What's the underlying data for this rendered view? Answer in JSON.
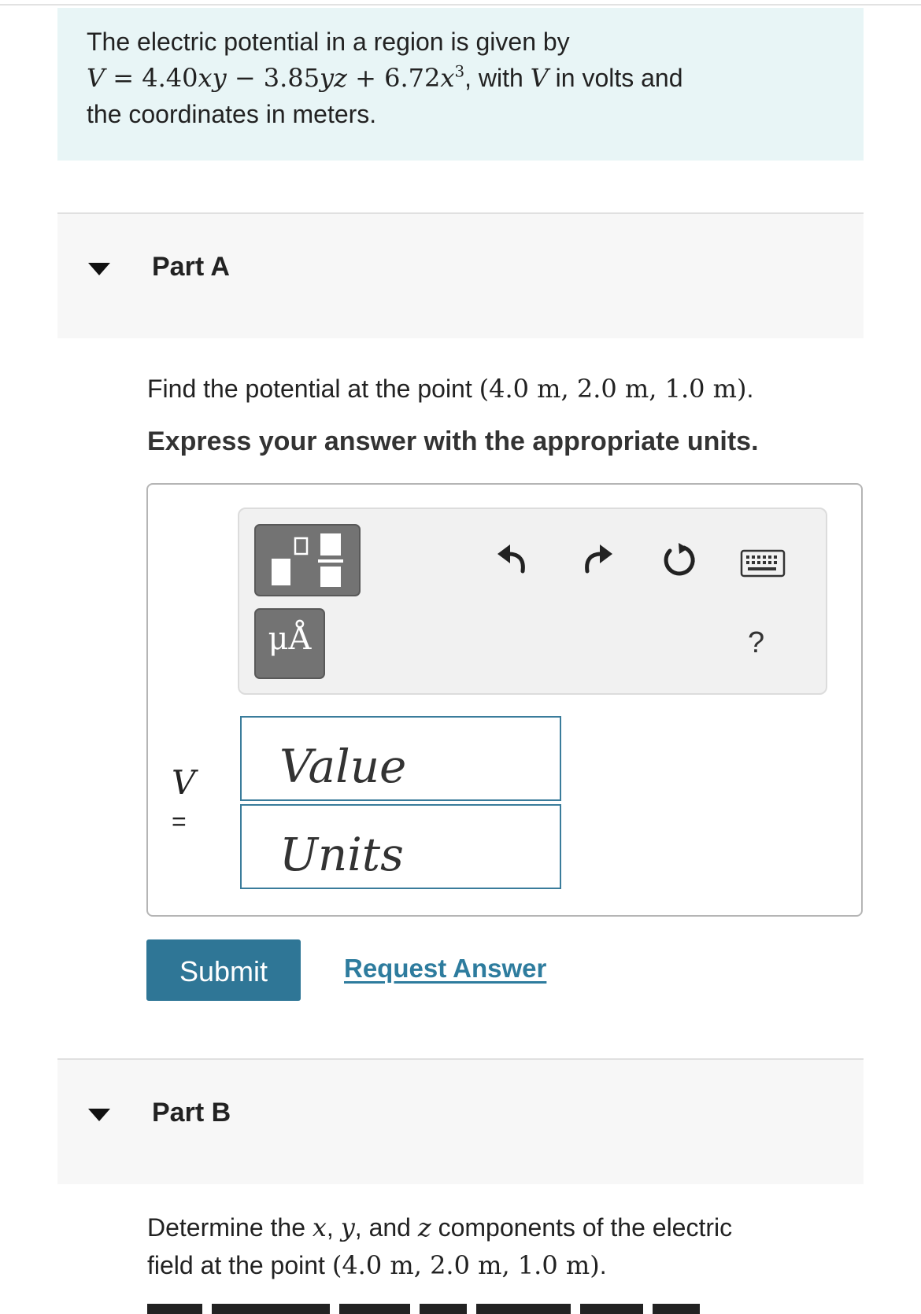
{
  "intro": {
    "line1": "The electric potential in a region is given by",
    "formula": {
      "lhs": "V",
      "eq": " = ",
      "term1": "4.40",
      "term1_vars": "xy",
      "op1": " − ",
      "term2": "3.85",
      "term2_vars": "yz",
      "op2": " + ",
      "term3": "6.72",
      "term3_var": "x",
      "term3_exp": "3"
    },
    "after_formula": ", with ",
    "v_symbol": "V",
    "after_v": " in volts and",
    "line3": "the coordinates in meters."
  },
  "part_a": {
    "title": "Part A",
    "question_prefix": "Find the potential at the point ",
    "point": "(4.0 m, 2.0 m, 1.0 m)",
    "question_suffix": ".",
    "instruction": "Express your answer with the appropriate units.",
    "toolbar": {
      "icons": [
        "templates-icon",
        "undo-icon",
        "redo-icon",
        "reset-icon",
        "keyboard-icon"
      ],
      "units_button_label": "μÅ",
      "help_label": "?"
    },
    "variable": "V",
    "equals": "=",
    "value_placeholder": "Value",
    "units_placeholder": "Units",
    "submit_label": "Submit",
    "request_answer_label": "Request Answer"
  },
  "part_b": {
    "title": "Part B",
    "line1_prefix": "Determine the ",
    "x": "x",
    "comma1": ", ",
    "y": "y",
    "and": ", and ",
    "z": "z",
    "line1_suffix": " components of the electric",
    "line2_prefix": "field at the point ",
    "point": "(4.0 m, 2.0 m, 1.0 m)",
    "line2_suffix": "."
  },
  "colors": {
    "intro_background": "#e8f5f6",
    "accent": "#2f7696",
    "link": "#2e7c9e",
    "input_border": "#3a7c9b",
    "toolbar_button": "#737373"
  }
}
